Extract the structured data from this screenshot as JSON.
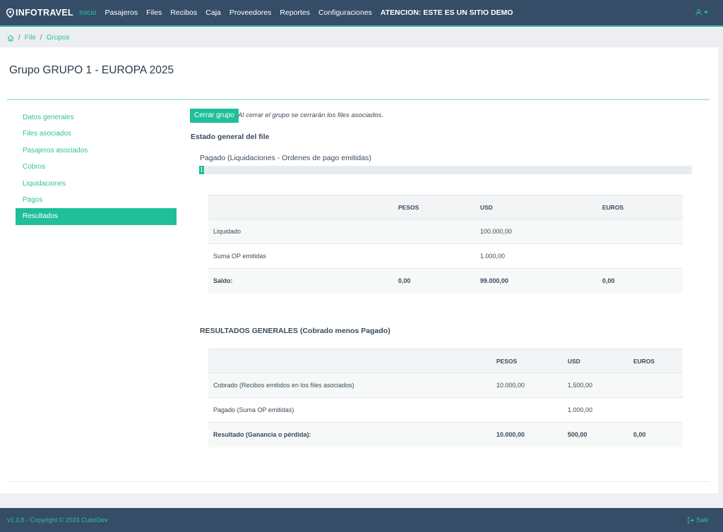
{
  "navbar": {
    "brand": "INFOTRAVEL",
    "items": [
      {
        "label": "Inicio",
        "active": true
      },
      {
        "label": "Pasajeros"
      },
      {
        "label": "Files"
      },
      {
        "label": "Recibos"
      },
      {
        "label": "Caja"
      },
      {
        "label": "Proveedores"
      },
      {
        "label": "Reportes"
      },
      {
        "label": "Configuraciones"
      }
    ],
    "warning": "ATENCION: ESTE ES UN SITIO DEMO",
    "user_icon": "user-icon",
    "caret_icon": "caret-down-icon"
  },
  "breadcrumb": {
    "home_icon": "home-icon",
    "items": [
      "File",
      "Grupos"
    ]
  },
  "page": {
    "title": "Grupo GRUPO 1 - EUROPA 2025"
  },
  "side_menu": {
    "items": [
      {
        "label": "Datos generales"
      },
      {
        "label": "Files asociados"
      },
      {
        "label": "Pasajeros asociados"
      },
      {
        "label": "Cobros"
      },
      {
        "label": "Liquidaciones"
      },
      {
        "label": "Pagos"
      },
      {
        "label": "Resultados",
        "active": true
      }
    ]
  },
  "actions": {
    "close_group_label": "Cerrar grupo",
    "close_group_note": "Al cerrar el grupo se cerrarán los files asociados."
  },
  "estado": {
    "heading": "Estado general del file",
    "progress_label": "Pagado (Liquidaciones - Ordenes de pago emitidas)",
    "progress_percent": 1,
    "progress_text": "1",
    "table": {
      "headers": [
        "",
        "PESOS",
        "USD",
        "EUROS"
      ],
      "rows": [
        [
          "Liquidado",
          "",
          "100.000,00",
          ""
        ],
        [
          "Suma OP emitidas",
          "",
          "1.000,00",
          ""
        ],
        [
          "Saldo:",
          "0,00",
          "99.000,00",
          "0,00"
        ]
      ]
    }
  },
  "resultados": {
    "heading": "RESULTADOS GENERALES (Cobrado menos Pagado)",
    "table": {
      "headers": [
        "",
        "PESOS",
        "USD",
        "EUROS"
      ],
      "rows": [
        [
          "Cobrado (Recibos emitidos en los files asociados)",
          "10.000,00",
          "1.500,00",
          ""
        ],
        [
          "Pagado (Suma OP emitidas)",
          "",
          "1.000,00",
          ""
        ],
        [
          "Resultado (Ganancia o pérdida):",
          "10.000,00",
          "500,00",
          "0,00"
        ]
      ]
    }
  },
  "footer": {
    "copyright": "v1.3.8 - Copyright © 2024 CuboDev",
    "logout_label": "Salir"
  },
  "colors": {
    "navbar": "#354d66",
    "accent": "#1fbf9a",
    "link": "#2fbfa0"
  }
}
